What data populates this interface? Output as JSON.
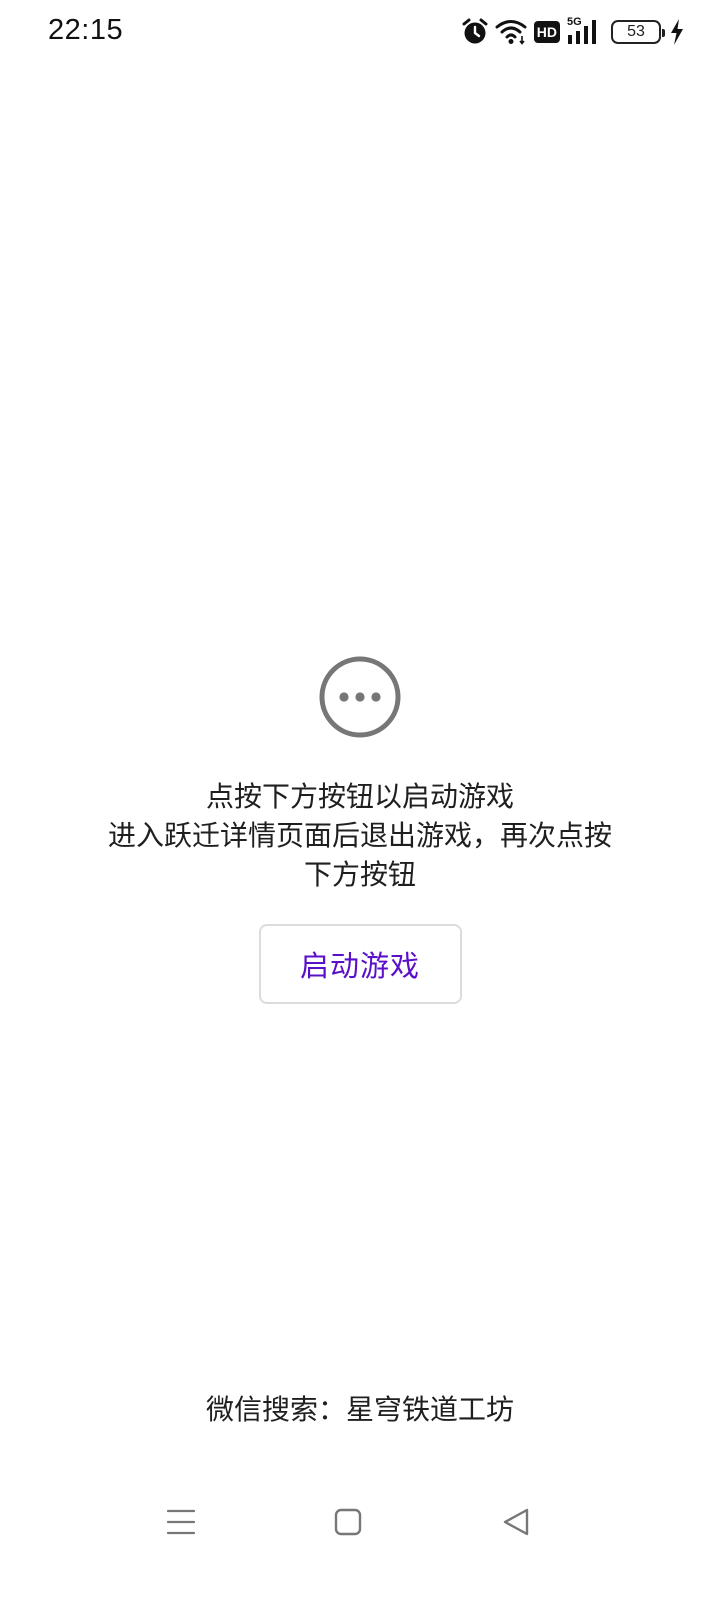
{
  "status_bar": {
    "time": "22:15",
    "icons": [
      "alarm-icon",
      "wifi-icon",
      "hd-icon",
      "signal-5g-icon",
      "battery-icon",
      "charging-icon"
    ],
    "network_label": "5G",
    "hd_label": "HD",
    "battery_level": "53"
  },
  "main": {
    "icon": "more-horizontal-icon",
    "message_lines": [
      "点按下方按钮以启动游戏",
      "进入跃迁详情页面后退出游戏，再次点按",
      "下方按钮"
    ],
    "launch_button_label": "启动游戏"
  },
  "footer": {
    "hint": "微信搜索：星穹铁道工坊"
  },
  "nav_bar": {
    "icons": [
      "menu-icon",
      "home-icon",
      "back-icon"
    ]
  },
  "colors": {
    "accent": "#5a10c8",
    "text": "#1f1f1f",
    "icon_gray": "#777777",
    "background": "#ffffff"
  }
}
